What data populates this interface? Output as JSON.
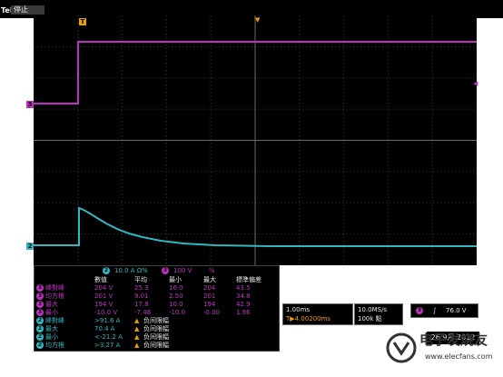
{
  "header": {
    "brand": "Tek",
    "status": "停止"
  },
  "markers": {
    "trigger": "T",
    "ch3": "3",
    "ch2": "2"
  },
  "meas_header": {
    "ch2_scale": "10.0 A Ω%",
    "ch3_badge": "3",
    "ch3_scale": "100 V",
    "extra": "%"
  },
  "meas_columns": [
    "數值",
    "平均",
    "最小",
    "最大",
    "標準偏差"
  ],
  "meas_rows": [
    {
      "ch": "3",
      "label": "峰對峰",
      "values": [
        "204 V",
        "25.3",
        "16.0",
        "204",
        "43.5"
      ],
      "color": "#c030c0"
    },
    {
      "ch": "3",
      "label": "均方根",
      "values": [
        "201 V",
        "9.01",
        "2.50",
        "201",
        "34.8"
      ],
      "color": "#c030c0"
    },
    {
      "ch": "3",
      "label": "最大",
      "values": [
        "194 V",
        "17.8",
        "10.0",
        "194",
        "42.9"
      ],
      "color": "#c030c0"
    },
    {
      "ch": "3",
      "label": "最小",
      "values": [
        "-10.0 V",
        "-7.48",
        "-10.0",
        "-0.00",
        "1.96"
      ],
      "color": "#c030c0"
    },
    {
      "ch": "2",
      "label": "峰對峰",
      "values": [
        ">91.6 A",
        "负间限幅"
      ],
      "color": "#30b8c0"
    },
    {
      "ch": "2",
      "label": "最大",
      "values": [
        "70.4 A",
        "负间限幅"
      ],
      "color": "#30b8c0"
    },
    {
      "ch": "2",
      "label": "最小",
      "values": [
        "<-21.2 A",
        "负间限幅"
      ],
      "color": "#30b8c0"
    },
    {
      "ch": "2",
      "label": "均方根",
      "values": [
        ">3.27 A",
        "负间限幅"
      ],
      "color": "#30b8c0"
    }
  ],
  "timebase": {
    "tdiv": "1.00ms",
    "delay": "T▶4.00200ms"
  },
  "acq": {
    "rate": "10.0MS/s",
    "points": "100k 點"
  },
  "trigger_box": {
    "ch": "3",
    "slope": "∫",
    "level": "76.0 V"
  },
  "date": "26 9月 2012",
  "watermark": {
    "text": "电子发烧友",
    "url": "www.elecfans.com"
  },
  "colors": {
    "ch2": "#30b8c0",
    "ch3": "#c030c0",
    "trigger": "#e8a000"
  }
}
